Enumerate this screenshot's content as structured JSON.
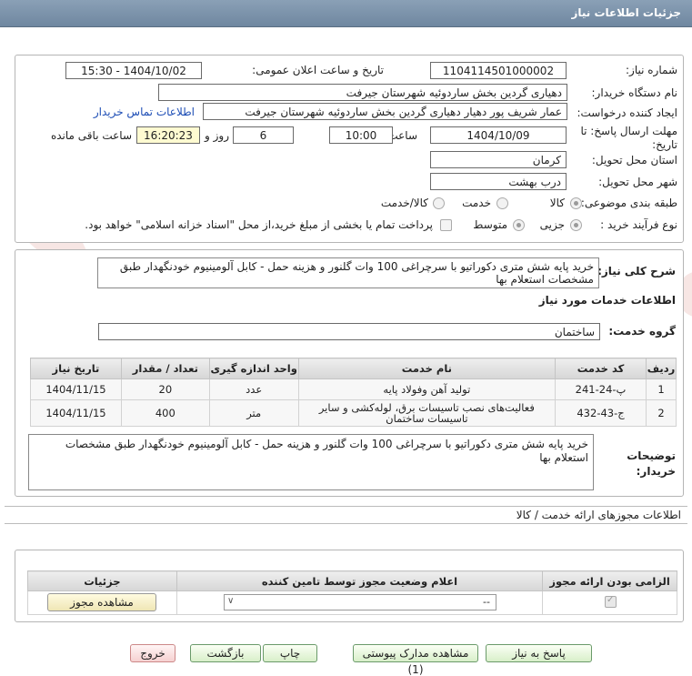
{
  "header": {
    "title": "جزئیات اطلاعات نیاز"
  },
  "form": {
    "need_number_label": "شماره نیاز:",
    "need_number": "1104114501000002",
    "announce_label": "تاریخ و ساعت اعلان عمومی:",
    "announce_value": "1404/10/02 - 15:30",
    "buyer_org_label": "نام دستگاه خریدار:",
    "buyer_org": "دهیاری گردین بخش ساردوئیه شهرستان جیرفت",
    "creator_label": "ایجاد کننده درخواست:",
    "creator": "عمار شریف پور دهیار دهیاری گردین بخش ساردوئیه شهرستان جیرفت",
    "contact_link": "اطلاعات تماس خریدار",
    "deadline_label": "مهلت ارسال پاسخ: تا تاریخ:",
    "deadline_date": "1404/10/09",
    "time_label": "ساعت",
    "deadline_time": "10:00",
    "days_value": "6",
    "days_label": "روز و",
    "remaining_time": "16:20:23",
    "remaining_label": "ساعت باقی مانده",
    "province_label": "استان محل تحویل:",
    "province": "کرمان",
    "city_label": "شهر محل تحویل:",
    "city": "درب بهشت",
    "category_label": "طبقه بندی موضوعی:",
    "category_options": [
      "کالا",
      "خدمت",
      "کالا/خدمت"
    ],
    "category_selected": "کالا",
    "process_label": "نوع فرآیند خرید :",
    "process_options": [
      "جزیی",
      "متوسط"
    ],
    "process_selected": "جزیی",
    "payment_note": "پرداخت تمام یا بخشی از مبلغ خرید،از محل \"اسناد خزانه اسلامی\" خواهد بود."
  },
  "description": {
    "label": "شرح کلی نیاز:",
    "text": "خرید پایه شش متری دکوراتیو با سرچراغی 100 وات گلنور و هزینه حمل - کابل آلومینیوم خودنگهدار طبق مشخصات استعلام بها"
  },
  "services": {
    "title": "اطلاعات خدمات مورد نیاز",
    "group_label": "گروه خدمت:",
    "group_value": "ساختمان",
    "columns": [
      "ردیف",
      "کد خدمت",
      "نام خدمت",
      "واحد اندازه گیری",
      "تعداد / مقدار",
      "تاریخ نیاز"
    ],
    "rows": [
      {
        "idx": "1",
        "code": "پ-24-241",
        "name": "تولید آهن وفولاد پایه",
        "unit": "عدد",
        "qty": "20",
        "date": "1404/11/15"
      },
      {
        "idx": "2",
        "code": "ج-43-432",
        "name": "فعالیت‌های نصب تاسیسات برق، لوله‌کشی و سایر تاسیسات ساختمان",
        "unit": "متر",
        "qty": "400",
        "date": "1404/11/15"
      }
    ]
  },
  "buyer_notes": {
    "label": "توضیحات خریدار:",
    "text": "خرید پایه شش متری دکوراتیو با سرچراغی 100 وات گلنور و هزینه حمل - کابل آلومینیوم خودنگهدار طبق مشخصات استعلام بها"
  },
  "permits": {
    "title": "اطلاعات مجوزهای ارائه خدمت / کالا",
    "columns": [
      "الزامی بودن ارائه مجوز",
      "اعلام وضعیت مجوز توسط تامین کننده",
      "جزئیات"
    ],
    "select_value": "--",
    "view_button": "مشاهده مجوز"
  },
  "buttons": {
    "reply": "پاسخ به نیاز",
    "attachments": "مشاهده مدارک پیوستی (1)",
    "print": "چاپ",
    "back": "بازگشت",
    "exit": "خروج"
  },
  "watermark": {
    "text": "AriaTender.net",
    "color": "#c0392b"
  }
}
